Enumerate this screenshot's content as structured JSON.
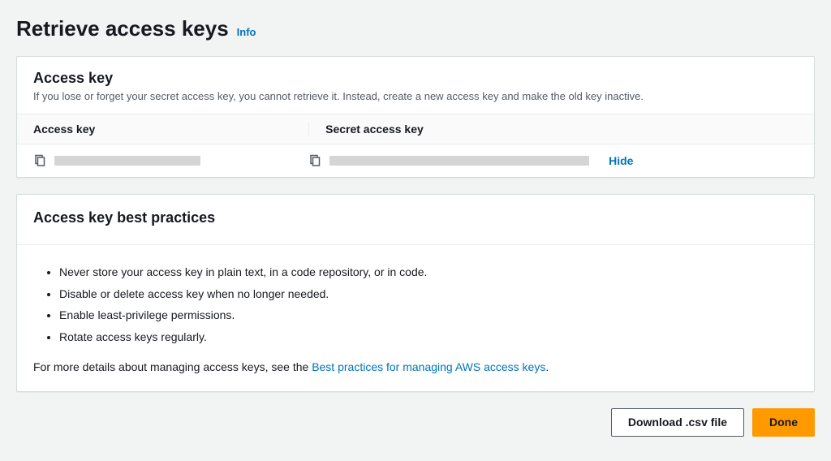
{
  "header": {
    "title": "Retrieve access keys",
    "info_label": "Info"
  },
  "access_key_panel": {
    "title": "Access key",
    "subtitle": "If you lose or forget your secret access key, you cannot retrieve it. Instead, create a new access key and make the old key inactive.",
    "col1_label": "Access key",
    "col2_label": "Secret access key",
    "access_key_value": "",
    "secret_key_value": "",
    "toggle_label": "Hide"
  },
  "best_practices": {
    "title": "Access key best practices",
    "items": [
      "Never store your access key in plain text, in a code repository, or in code.",
      "Disable or delete access key when no longer needed.",
      "Enable least-privilege permissions.",
      "Rotate access keys regularly."
    ],
    "more_prefix": "For more details about managing access keys, see the ",
    "more_link": "Best practices for managing AWS access keys",
    "more_suffix": "."
  },
  "actions": {
    "download_label": "Download .csv file",
    "done_label": "Done"
  }
}
